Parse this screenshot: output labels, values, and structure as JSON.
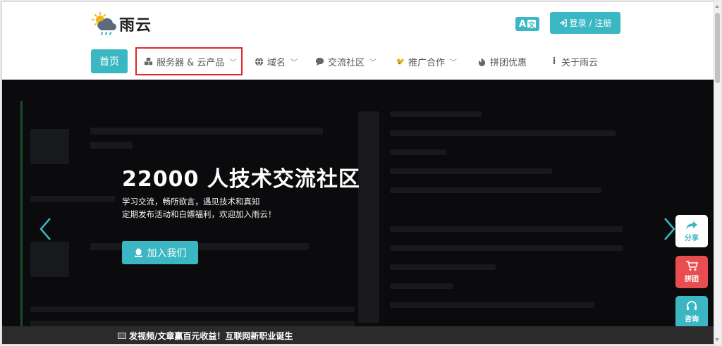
{
  "brand": {
    "name": "雨云"
  },
  "header": {
    "lang_label": "A",
    "lang_glyph": "",
    "login_label": "登录 / 注册"
  },
  "nav": {
    "items": [
      {
        "label": "首页",
        "icon": "none",
        "active": true
      },
      {
        "label": "服务器 & 云产品",
        "icon": "cubes-icon",
        "has_dropdown": true,
        "highlighted": true
      },
      {
        "label": "域名",
        "icon": "globe-icon",
        "has_dropdown": true
      },
      {
        "label": "交流社区",
        "icon": "chat-icon",
        "has_dropdown": true
      },
      {
        "label": "推广合作",
        "icon": "handshake-icon",
        "has_dropdown": true
      },
      {
        "label": "拼团优惠",
        "icon": "fire-icon",
        "has_dropdown": false
      },
      {
        "label": "关于雨云",
        "icon": "info-icon",
        "has_dropdown": false
      }
    ]
  },
  "hero": {
    "title": "22000 人技术交流社区",
    "sub_line1": "学习交流，畅所欲言，遇见技术和真知",
    "sub_line2": "定期发布活动和白嫖福利，欢迎加入雨云！",
    "join_label": "加入我们"
  },
  "side": {
    "share_label": "分享",
    "group_label": "拼团",
    "consult_label": "咨询"
  },
  "ticker": {
    "text": "发视频/文章赢百元收益！互联网新职业诞生"
  },
  "colors": {
    "accent": "#3ab7c3",
    "highlight_border": "#e3262b",
    "group_red": "#e84e4f",
    "hero_bg": "#0b0b0d"
  }
}
